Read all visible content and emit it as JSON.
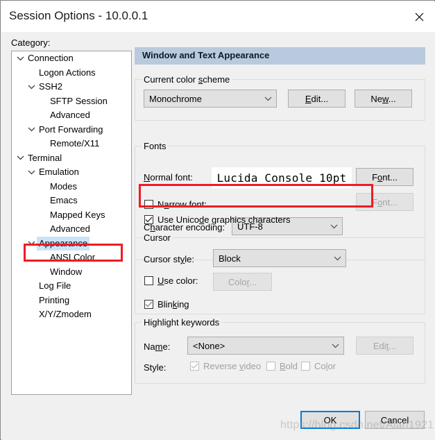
{
  "window": {
    "title": "Session Options - 10.0.0.1",
    "close_icon": "close-icon"
  },
  "sidebar": {
    "label": "Category:",
    "items": [
      {
        "label": "Connection",
        "indent": 0,
        "expander": "chevron-down",
        "selected": false
      },
      {
        "label": "Logon Actions",
        "indent": 1,
        "expander": "none",
        "selected": false
      },
      {
        "label": "SSH2",
        "indent": 1,
        "expander": "chevron-down",
        "selected": false
      },
      {
        "label": "SFTP Session",
        "indent": 2,
        "expander": "none",
        "selected": false
      },
      {
        "label": "Advanced",
        "indent": 2,
        "expander": "none",
        "selected": false
      },
      {
        "label": "Port Forwarding",
        "indent": 1,
        "expander": "chevron-down",
        "selected": false
      },
      {
        "label": "Remote/X11",
        "indent": 2,
        "expander": "none",
        "selected": false
      },
      {
        "label": "Terminal",
        "indent": 0,
        "expander": "chevron-down",
        "selected": false
      },
      {
        "label": "Emulation",
        "indent": 1,
        "expander": "chevron-down",
        "selected": false
      },
      {
        "label": "Modes",
        "indent": 2,
        "expander": "none",
        "selected": false
      },
      {
        "label": "Emacs",
        "indent": 2,
        "expander": "none",
        "selected": false
      },
      {
        "label": "Mapped Keys",
        "indent": 2,
        "expander": "none",
        "selected": false
      },
      {
        "label": "Advanced",
        "indent": 2,
        "expander": "none",
        "selected": false
      },
      {
        "label": "Appearance",
        "indent": 1,
        "expander": "chevron-down",
        "selected": true
      },
      {
        "label": "ANSI Color",
        "indent": 2,
        "expander": "none",
        "selected": false
      },
      {
        "label": "Window",
        "indent": 2,
        "expander": "none",
        "selected": false
      },
      {
        "label": "Log File",
        "indent": 1,
        "expander": "none",
        "selected": false
      },
      {
        "label": "Printing",
        "indent": 1,
        "expander": "none",
        "selected": false
      },
      {
        "label": "X/Y/Zmodem",
        "indent": 1,
        "expander": "none",
        "selected": false
      }
    ]
  },
  "panel": {
    "header": "Window and Text Appearance",
    "color_scheme": {
      "legend": "Current color scheme",
      "value": "Monochrome",
      "edit_button": "Edit...",
      "new_button": "New..."
    },
    "fonts": {
      "legend": "Fonts",
      "normal_font_label": "Normal font:",
      "normal_font_value": "Lucida Console 10pt",
      "normal_font_button": "Font...",
      "narrow_font_label": "Narrow font:",
      "narrow_font_checked": false,
      "narrow_font_button": "Font...",
      "narrow_font_button_disabled": true,
      "char_encoding_label": "Character encoding:",
      "char_encoding_value": "UTF-8",
      "unicode_graphics_label": "Use Unicode graphics characters",
      "unicode_graphics_checked": true
    },
    "cursor": {
      "legend": "Cursor",
      "style_label": "Cursor style:",
      "style_value": "Block",
      "use_color_label": "Use color:",
      "use_color_checked": false,
      "color_button": "Color...",
      "color_button_disabled": true,
      "blinking_label": "Blinking",
      "blinking_checked": true
    },
    "highlight": {
      "legend": "Highlight keywords",
      "name_label": "Name:",
      "name_value": "<None>",
      "edit_button": "Edit...",
      "edit_button_disabled": true,
      "style_label": "Style:",
      "reverse_video_label": "Reverse video",
      "reverse_video_checked": true,
      "bold_label": "Bold",
      "bold_checked": false,
      "color_label": "Color",
      "color_checked": false
    }
  },
  "footer": {
    "ok_label": "OK",
    "cancel_label": "Cancel"
  },
  "watermark": "https://blog.csdn.net/Alan1921",
  "annotations": {
    "accent_color": "#ee1c25",
    "highlight_selection_color": "#cce3f7",
    "header_band_color": "#b9cade",
    "focus_color": "#0078d7"
  }
}
